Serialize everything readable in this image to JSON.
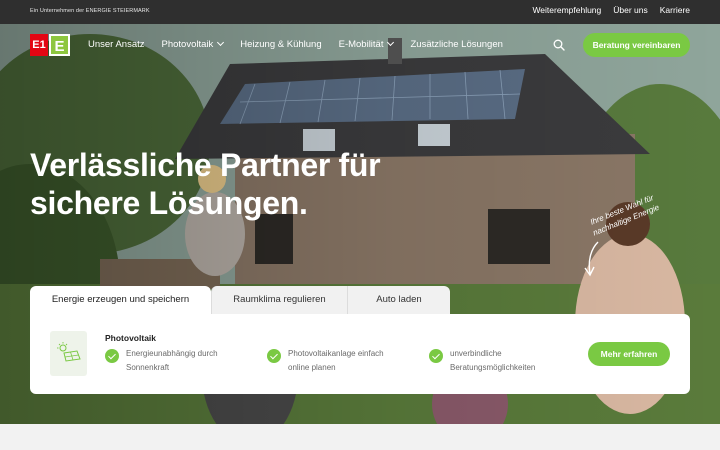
{
  "topbar": {
    "tagline": "Ein Unternehmen der ENERGIE STEIERMARK",
    "links": [
      "Weiterempfehlung",
      "Über uns",
      "Karriere"
    ]
  },
  "logo": {
    "left": "E1",
    "right": "E"
  },
  "nav": {
    "items": [
      "Unser Ansatz",
      "Photovoltaik",
      "Heizung & Kühlung",
      "E-Mobilität",
      "Zusätzliche Lösungen"
    ],
    "cta": "Beratung vereinbaren"
  },
  "hero": {
    "headline_line1": "Verlässliche Partner für",
    "headline_line2": "sichere Lösungen.",
    "script_note": "Ihre beste Wahl für nachhaltige Energie"
  },
  "tabs": [
    "Energie erzeugen und speichern",
    "Raumklima regulieren",
    "Auto laden"
  ],
  "panel": {
    "title": "Photovoltaik",
    "features": [
      {
        "line1": "Energieunabhängig durch",
        "line2": "Sonnenkraft"
      },
      {
        "line1": "Photovoltaikanlage einfach",
        "line2": "online planen"
      },
      {
        "line1": "unverbindliche",
        "line2": "Beratungsmöglichkeiten"
      }
    ],
    "button": "Mehr erfahren"
  },
  "colors": {
    "accent_green": "#7ac943",
    "brand_red": "#e30613",
    "topbar": "#2f2f2f"
  },
  "icons": [
    "search-icon",
    "chevron-down-icon",
    "solar-panel-icon",
    "check-icon",
    "arrow-down-icon"
  ]
}
